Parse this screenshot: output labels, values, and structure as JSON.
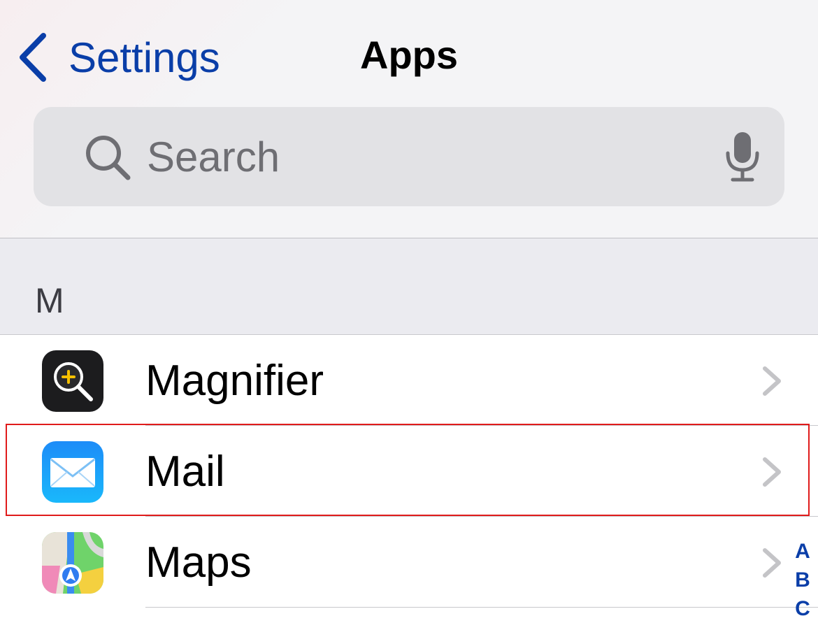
{
  "nav": {
    "back_label": "Settings",
    "title": "Apps"
  },
  "search": {
    "placeholder": "Search",
    "value": ""
  },
  "section": {
    "letter": "M"
  },
  "apps": [
    {
      "label": "Magnifier",
      "icon": "magnifier-app-icon"
    },
    {
      "label": "Mail",
      "icon": "mail-app-icon"
    },
    {
      "label": "Maps",
      "icon": "maps-app-icon"
    }
  ],
  "index": [
    "A",
    "B",
    "C"
  ],
  "colors": {
    "accent": "#0a3ea8",
    "highlight": "#e01b1b",
    "section_bg": "#ebebf0",
    "search_bg": "#e2e2e5"
  }
}
